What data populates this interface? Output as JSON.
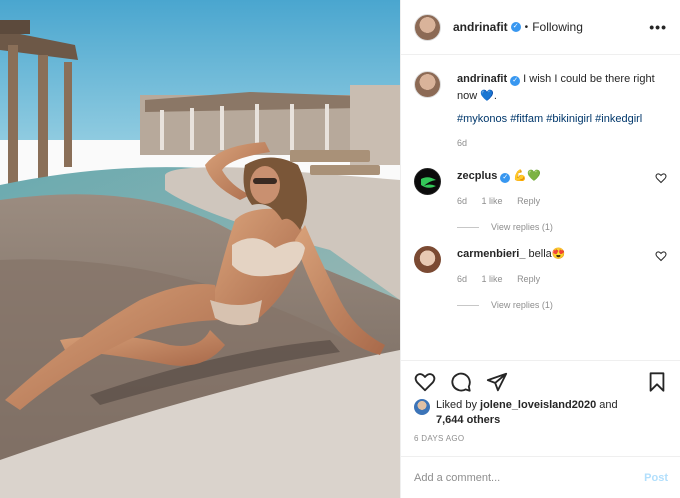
{
  "post": {
    "username": "andrinafit",
    "dot": "•",
    "following_label": "Following",
    "more_label": "•••"
  },
  "caption": {
    "username": "andrinafit",
    "text": " I wish I could be there right now 💙.",
    "hashtags": "#mykonos #fitfam #bikinigirl #inkedgirl",
    "age": "6d"
  },
  "comments": [
    {
      "username": "zecplus",
      "text": " 💪💚",
      "age": "6d",
      "likes": "1 like",
      "reply": "Reply",
      "view_replies": "View replies (1)"
    },
    {
      "username": "carmenbieri_",
      "text": " bella😍",
      "age": "6d",
      "likes": "1 like",
      "reply": "Reply",
      "view_replies": "View replies (1)"
    }
  ],
  "likes": {
    "prefix": "Liked by ",
    "user": "jolene_loveisland2020",
    "and": " and",
    "count": "7,644 others"
  },
  "posted_ago": "6 DAYS AGO",
  "add_comment": {
    "placeholder": "Add a comment...",
    "post_label": "Post"
  },
  "colors": {
    "verified": "#3897f0",
    "link": "#00376b",
    "post_disabled": "#b2dffc"
  }
}
